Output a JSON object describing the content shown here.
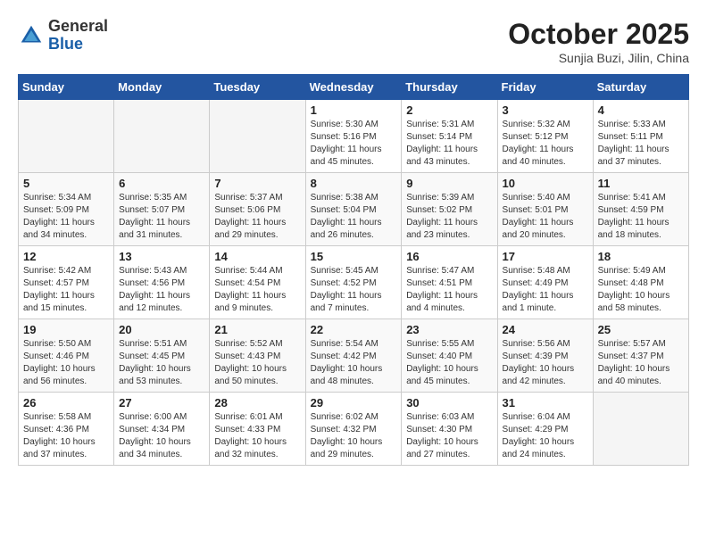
{
  "header": {
    "logo_general": "General",
    "logo_blue": "Blue",
    "month": "October 2025",
    "location": "Sunjia Buzi, Jilin, China"
  },
  "weekdays": [
    "Sunday",
    "Monday",
    "Tuesday",
    "Wednesday",
    "Thursday",
    "Friday",
    "Saturday"
  ],
  "weeks": [
    [
      {
        "day": "",
        "info": ""
      },
      {
        "day": "",
        "info": ""
      },
      {
        "day": "",
        "info": ""
      },
      {
        "day": "1",
        "info": "Sunrise: 5:30 AM\nSunset: 5:16 PM\nDaylight: 11 hours\nand 45 minutes."
      },
      {
        "day": "2",
        "info": "Sunrise: 5:31 AM\nSunset: 5:14 PM\nDaylight: 11 hours\nand 43 minutes."
      },
      {
        "day": "3",
        "info": "Sunrise: 5:32 AM\nSunset: 5:12 PM\nDaylight: 11 hours\nand 40 minutes."
      },
      {
        "day": "4",
        "info": "Sunrise: 5:33 AM\nSunset: 5:11 PM\nDaylight: 11 hours\nand 37 minutes."
      }
    ],
    [
      {
        "day": "5",
        "info": "Sunrise: 5:34 AM\nSunset: 5:09 PM\nDaylight: 11 hours\nand 34 minutes."
      },
      {
        "day": "6",
        "info": "Sunrise: 5:35 AM\nSunset: 5:07 PM\nDaylight: 11 hours\nand 31 minutes."
      },
      {
        "day": "7",
        "info": "Sunrise: 5:37 AM\nSunset: 5:06 PM\nDaylight: 11 hours\nand 29 minutes."
      },
      {
        "day": "8",
        "info": "Sunrise: 5:38 AM\nSunset: 5:04 PM\nDaylight: 11 hours\nand 26 minutes."
      },
      {
        "day": "9",
        "info": "Sunrise: 5:39 AM\nSunset: 5:02 PM\nDaylight: 11 hours\nand 23 minutes."
      },
      {
        "day": "10",
        "info": "Sunrise: 5:40 AM\nSunset: 5:01 PM\nDaylight: 11 hours\nand 20 minutes."
      },
      {
        "day": "11",
        "info": "Sunrise: 5:41 AM\nSunset: 4:59 PM\nDaylight: 11 hours\nand 18 minutes."
      }
    ],
    [
      {
        "day": "12",
        "info": "Sunrise: 5:42 AM\nSunset: 4:57 PM\nDaylight: 11 hours\nand 15 minutes."
      },
      {
        "day": "13",
        "info": "Sunrise: 5:43 AM\nSunset: 4:56 PM\nDaylight: 11 hours\nand 12 minutes."
      },
      {
        "day": "14",
        "info": "Sunrise: 5:44 AM\nSunset: 4:54 PM\nDaylight: 11 hours\nand 9 minutes."
      },
      {
        "day": "15",
        "info": "Sunrise: 5:45 AM\nSunset: 4:52 PM\nDaylight: 11 hours\nand 7 minutes."
      },
      {
        "day": "16",
        "info": "Sunrise: 5:47 AM\nSunset: 4:51 PM\nDaylight: 11 hours\nand 4 minutes."
      },
      {
        "day": "17",
        "info": "Sunrise: 5:48 AM\nSunset: 4:49 PM\nDaylight: 11 hours\nand 1 minute."
      },
      {
        "day": "18",
        "info": "Sunrise: 5:49 AM\nSunset: 4:48 PM\nDaylight: 10 hours\nand 58 minutes."
      }
    ],
    [
      {
        "day": "19",
        "info": "Sunrise: 5:50 AM\nSunset: 4:46 PM\nDaylight: 10 hours\nand 56 minutes."
      },
      {
        "day": "20",
        "info": "Sunrise: 5:51 AM\nSunset: 4:45 PM\nDaylight: 10 hours\nand 53 minutes."
      },
      {
        "day": "21",
        "info": "Sunrise: 5:52 AM\nSunset: 4:43 PM\nDaylight: 10 hours\nand 50 minutes."
      },
      {
        "day": "22",
        "info": "Sunrise: 5:54 AM\nSunset: 4:42 PM\nDaylight: 10 hours\nand 48 minutes."
      },
      {
        "day": "23",
        "info": "Sunrise: 5:55 AM\nSunset: 4:40 PM\nDaylight: 10 hours\nand 45 minutes."
      },
      {
        "day": "24",
        "info": "Sunrise: 5:56 AM\nSunset: 4:39 PM\nDaylight: 10 hours\nand 42 minutes."
      },
      {
        "day": "25",
        "info": "Sunrise: 5:57 AM\nSunset: 4:37 PM\nDaylight: 10 hours\nand 40 minutes."
      }
    ],
    [
      {
        "day": "26",
        "info": "Sunrise: 5:58 AM\nSunset: 4:36 PM\nDaylight: 10 hours\nand 37 minutes."
      },
      {
        "day": "27",
        "info": "Sunrise: 6:00 AM\nSunset: 4:34 PM\nDaylight: 10 hours\nand 34 minutes."
      },
      {
        "day": "28",
        "info": "Sunrise: 6:01 AM\nSunset: 4:33 PM\nDaylight: 10 hours\nand 32 minutes."
      },
      {
        "day": "29",
        "info": "Sunrise: 6:02 AM\nSunset: 4:32 PM\nDaylight: 10 hours\nand 29 minutes."
      },
      {
        "day": "30",
        "info": "Sunrise: 6:03 AM\nSunset: 4:30 PM\nDaylight: 10 hours\nand 27 minutes."
      },
      {
        "day": "31",
        "info": "Sunrise: 6:04 AM\nSunset: 4:29 PM\nDaylight: 10 hours\nand 24 minutes."
      },
      {
        "day": "",
        "info": ""
      }
    ]
  ]
}
